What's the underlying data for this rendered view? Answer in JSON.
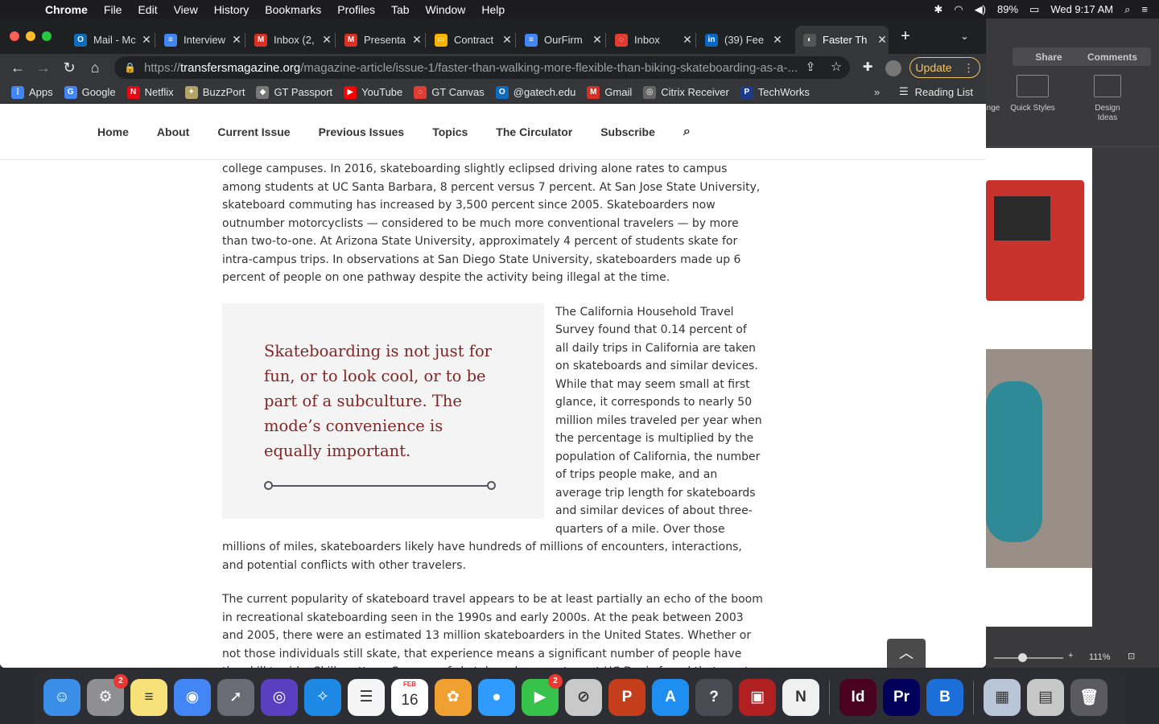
{
  "menubar": {
    "app": "Chrome",
    "items": [
      "File",
      "Edit",
      "View",
      "History",
      "Bookmarks",
      "Profiles",
      "Tab",
      "Window",
      "Help"
    ],
    "battery": "89%",
    "clock": "Wed 9:17 AM"
  },
  "tabs": [
    {
      "title": "Mail - Mc",
      "color": "#0f6cbd",
      "glyph": "O"
    },
    {
      "title": "Interview",
      "color": "#4285f4",
      "glyph": "≡"
    },
    {
      "title": "Inbox (2,",
      "color": "#d93025",
      "glyph": "M"
    },
    {
      "title": "Presenta",
      "color": "#d93025",
      "glyph": "M"
    },
    {
      "title": "Contract",
      "color": "#f4b400",
      "glyph": "▭"
    },
    {
      "title": "OurFirm",
      "color": "#4285f4",
      "glyph": "≡"
    },
    {
      "title": "Inbox",
      "color": "#e03c31",
      "glyph": "◌"
    },
    {
      "title": "(39) Fee",
      "color": "#0a66c2",
      "glyph": "in"
    },
    {
      "title": "Faster Th",
      "color": "#555",
      "glyph": "◐"
    }
  ],
  "toolbar": {
    "url_scheme": "https://",
    "url_host": "transfersmagazine.org",
    "url_path": "/magazine-article/issue-1/faster-than-walking-more-flexible-than-biking-skateboarding-as-a-...",
    "update_label": "Update"
  },
  "bookmarks": [
    {
      "label": "Apps",
      "color": "#4285f4",
      "glyph": "⋮"
    },
    {
      "label": "Google",
      "color": "#4285f4",
      "glyph": "G"
    },
    {
      "label": "Netflix",
      "color": "#e50914",
      "glyph": "N"
    },
    {
      "label": "BuzzPort",
      "color": "#b3a369",
      "glyph": "✦"
    },
    {
      "label": "GT Passport",
      "color": "#777",
      "glyph": "◆"
    },
    {
      "label": "YouTube",
      "color": "#ff0000",
      "glyph": "▶"
    },
    {
      "label": "GT Canvas",
      "color": "#e03c31",
      "glyph": "◌"
    },
    {
      "label": "@gatech.edu",
      "color": "#0f6cbd",
      "glyph": "O"
    },
    {
      "label": "Gmail",
      "color": "#d93025",
      "glyph": "M"
    },
    {
      "label": "Citrix Receiver",
      "color": "#666",
      "glyph": "◎"
    },
    {
      "label": "TechWorks",
      "color": "#1e3a8a",
      "glyph": "P"
    }
  ],
  "reading_list": "Reading List",
  "site_nav": [
    "Home",
    "About",
    "Current Issue",
    "Previous Issues",
    "Topics",
    "The Circulator",
    "Subscribe"
  ],
  "article": {
    "p1": "college campuses. In 2016, skateboarding slightly eclipsed driving alone rates to campus among students at UC Santa Barbara, 8 percent versus 7 percent. At San Jose State University, skateboard commuting has increased by 3,500 percent since 2005. Skateboarders now outnumber motorcyclists — considered to be much more conventional travelers — by more than two-to-one. At Arizona State University, approximately 4 percent of students skate for intra-campus trips. In observations at San Diego State University, skateboarders made up 6 percent of people on one pathway despite the activity being illegal at the time.",
    "pull_quote": "Skateboarding is not just for fun, or to look cool, or to be part of a subculture. The mode’s convenience is equally important.",
    "p2": "The California Household Travel Survey found that 0.14 percent of all daily trips in California are taken on skateboards and similar devices. While that may seem small at first glance, it corresponds to nearly 50 million miles traveled per year when the percentage is multiplied by the population of California, the number of trips people make, and an average trip length for skateboards and similar devices of about three-quarters of a mile. Over those millions of miles, skateboarders likely have hundreds of millions of encounters, interactions, and potential conflicts with other travelers.",
    "p3": "The current popularity of skateboard travel appears to be at least partially an echo of the boom in recreational skateboarding seen in the 1990s and early 2000s. At the peak between 2003 and 2005, there were an estimated 13 million skateboarders in the United States. Whether or not those individuals still skate, that experience means a significant number of people have the skill to ride. Skill matters: Surveys of skateboard commuters at UC Davis found that most began skateboarding initially for recreation, not as a commute mode."
  },
  "background_app": {
    "share": "Share",
    "comments": "Comments",
    "ribbon_left": "nge",
    "quick_styles": "Quick Styles",
    "design_ideas": "Design Ideas",
    "zoom": "111%"
  },
  "dock": [
    {
      "name": "finder",
      "color": "#3b8ee8",
      "glyph": "☺"
    },
    {
      "name": "system-preferences",
      "color": "#8e8e93",
      "glyph": "⚙",
      "badge": "2"
    },
    {
      "name": "notes",
      "color": "#f7e27a",
      "glyph": "≡"
    },
    {
      "name": "chrome",
      "color": "#4285f4",
      "glyph": "◉"
    },
    {
      "name": "launchpad",
      "color": "#6b6b75",
      "glyph": "➚"
    },
    {
      "name": "siri",
      "color": "#5a3fc0",
      "glyph": "◎"
    },
    {
      "name": "safari",
      "color": "#1e88e5",
      "glyph": "✧"
    },
    {
      "name": "reminders",
      "color": "#f5f5f5",
      "glyph": "☰"
    },
    {
      "name": "calendar",
      "color": "#ffffff",
      "glyph": "16"
    },
    {
      "name": "photos",
      "color": "#f0a030",
      "glyph": "✿"
    },
    {
      "name": "messages",
      "color": "#2f9bff",
      "glyph": "●"
    },
    {
      "name": "facetime",
      "color": "#36c24b",
      "glyph": "▶",
      "badge": "2"
    },
    {
      "name": "blocked-app",
      "color": "#c9c9c9",
      "glyph": "⊘"
    },
    {
      "name": "powerpoint",
      "color": "#c43e1c",
      "glyph": "P"
    },
    {
      "name": "app-store",
      "color": "#1f8ef1",
      "glyph": "A"
    },
    {
      "name": "help",
      "color": "#4a4a52",
      "glyph": "?"
    },
    {
      "name": "photo-booth",
      "color": "#b02020",
      "glyph": "▣"
    },
    {
      "name": "news",
      "color": "#f0f0f0",
      "glyph": "N"
    },
    {
      "name": "indesign",
      "color": "#49021f",
      "glyph": "Id"
    },
    {
      "name": "premiere",
      "color": "#00005b",
      "glyph": "Pr"
    },
    {
      "name": "bluejeans",
      "color": "#1c6fd8",
      "glyph": "B"
    },
    {
      "name": "downloads-folder",
      "color": "#b8c6d8",
      "glyph": "▦"
    },
    {
      "name": "screenshots-folder",
      "color": "#c8c8c8",
      "glyph": "▤"
    },
    {
      "name": "trash",
      "color": "#5a5a60",
      "glyph": "🗑"
    }
  ],
  "calendar_month": "FEB"
}
